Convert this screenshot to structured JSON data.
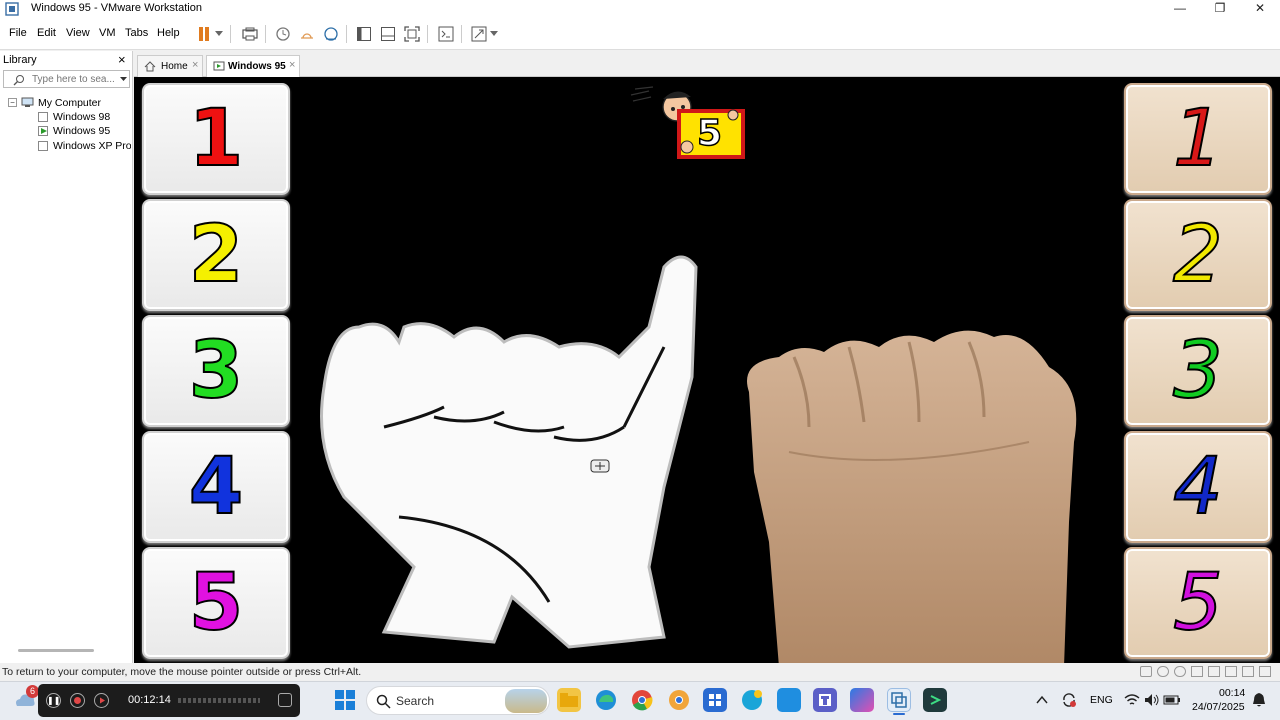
{
  "window": {
    "title": "Windows 95 - VMware Workstation",
    "controls": {
      "minimize": "—",
      "restore": "❐",
      "close": "✕"
    }
  },
  "menu": [
    "File",
    "Edit",
    "View",
    "VM",
    "Tabs",
    "Help"
  ],
  "library": {
    "header": "Library",
    "close": "×",
    "search_placeholder": "Type here to sea...",
    "tree": {
      "root": "My Computer",
      "items": [
        "Windows 98",
        "Windows 95",
        "Windows XP Prof"
      ]
    }
  },
  "tabs": [
    {
      "label": "Home",
      "close": "×"
    },
    {
      "label": "Windows 95",
      "close": "×"
    }
  ],
  "vm": {
    "left_numbers": [
      {
        "label": "1",
        "color": "#ee1111"
      },
      {
        "label": "2",
        "color": "#f5f000"
      },
      {
        "label": "3",
        "color": "#22dd22"
      },
      {
        "label": "4",
        "color": "#1133dd"
      },
      {
        "label": "5",
        "color": "#e011e0"
      }
    ],
    "right_numbers": [
      {
        "label": "1",
        "color": "#d81818"
      },
      {
        "label": "2",
        "color": "#f0e800"
      },
      {
        "label": "3",
        "color": "#11cc22"
      },
      {
        "label": "4",
        "color": "#1128c8"
      },
      {
        "label": "5",
        "color": "#d011dd"
      }
    ],
    "sign_number": "5"
  },
  "status": {
    "message": "To return to your computer, move the mouse pointer outside or press Ctrl+Alt."
  },
  "taskbar": {
    "weather_badge": "6",
    "recorder_time": "00:12:14",
    "search_label": "Search",
    "lang": "ENG",
    "time": "00:14",
    "date": "24/07/2025"
  }
}
